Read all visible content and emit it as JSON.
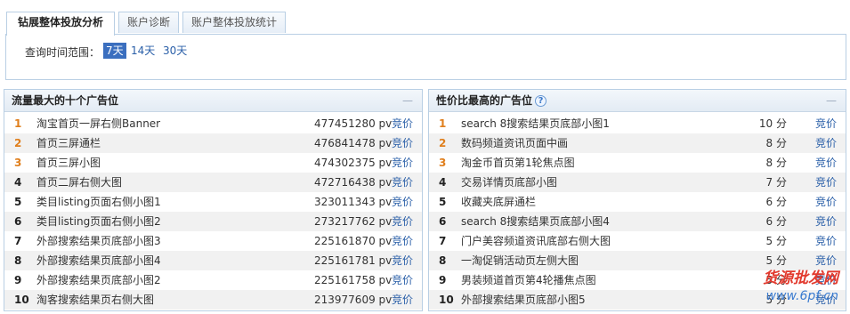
{
  "tabs": [
    "钻展整体投放分析",
    "账户诊断",
    "账户整体投放统计"
  ],
  "filter": {
    "label": "查询时间范围：",
    "ranges": [
      "7天",
      "14天",
      "30天"
    ],
    "selected": "7天"
  },
  "left_panel": {
    "title": "流量最大的十个广告位",
    "collapse": "—",
    "unit": "pv",
    "action": "竞价",
    "rows": [
      {
        "rank": "1",
        "name": "淘宝首页一屏右侧Banner",
        "pv": "477451280"
      },
      {
        "rank": "2",
        "name": "首页三屏通栏",
        "pv": "476841478"
      },
      {
        "rank": "3",
        "name": "首页三屏小图",
        "pv": "474302375"
      },
      {
        "rank": "4",
        "name": "首页二屏右侧大图",
        "pv": "472716438"
      },
      {
        "rank": "5",
        "name": "类目listing页面右侧小图1",
        "pv": "323011343"
      },
      {
        "rank": "6",
        "name": "类目listing页面右侧小图2",
        "pv": "273217762"
      },
      {
        "rank": "7",
        "name": "外部搜索结果页底部小图3",
        "pv": "225161870"
      },
      {
        "rank": "8",
        "name": "外部搜索结果页底部小图4",
        "pv": "225161781"
      },
      {
        "rank": "9",
        "name": "外部搜索结果页底部小图2",
        "pv": "225161758"
      },
      {
        "rank": "10",
        "name": "淘客搜索结果页右侧大图",
        "pv": "213977609"
      }
    ]
  },
  "right_panel": {
    "title": "性价比最高的广告位",
    "help": "?",
    "collapse": "—",
    "action": "竞价",
    "rows": [
      {
        "rank": "1",
        "name": "search 8搜索结果页底部小图1",
        "score": "10 分"
      },
      {
        "rank": "2",
        "name": "数码频道资讯页面中画",
        "score": "8 分"
      },
      {
        "rank": "3",
        "name": "淘金币首页第1轮焦点图",
        "score": "8 分"
      },
      {
        "rank": "4",
        "name": "交易详情页底部小图",
        "score": "7 分"
      },
      {
        "rank": "5",
        "name": "收藏夹底屏通栏",
        "score": "6 分"
      },
      {
        "rank": "6",
        "name": "search 8搜索结果页底部小图4",
        "score": "6 分"
      },
      {
        "rank": "7",
        "name": "门户美容频道资讯底部右侧大图",
        "score": "5 分"
      },
      {
        "rank": "8",
        "name": "一淘促销活动页左侧大图",
        "score": "5 分"
      },
      {
        "rank": "9",
        "name": "男装频道首页第4轮播焦点图",
        "score": "5 分"
      },
      {
        "rank": "10",
        "name": "外部搜索结果页底部小图5",
        "score": "5 分"
      }
    ]
  },
  "watermark": {
    "line1": "货源批发网",
    "line2": "www.6pf.cn"
  }
}
